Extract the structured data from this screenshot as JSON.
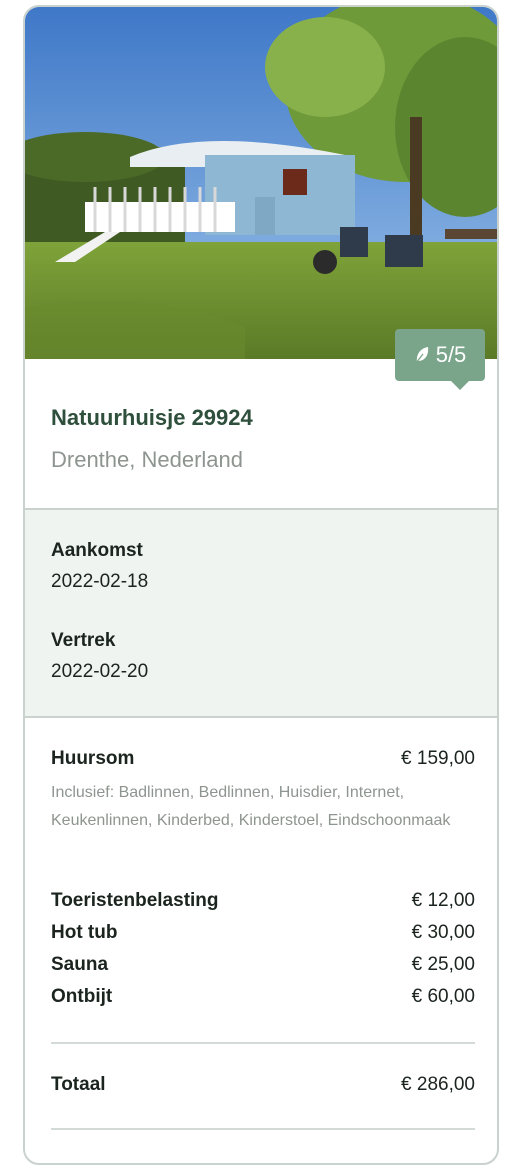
{
  "listing": {
    "name": "Natuurhuisje 29924",
    "location": "Drenthe, Nederland",
    "eco_rating": "5/5",
    "eco_icon": "leaf-icon"
  },
  "stay": {
    "arrival_label": "Aankomst",
    "arrival_date": "2022-02-18",
    "departure_label": "Vertrek",
    "departure_date": "2022-02-20"
  },
  "costs": {
    "rent": {
      "label": "Huursom",
      "amount": "€ 159,00"
    },
    "includes": "Inclusief: Badlinnen, Bedlinnen, Huisdier, Internet, Keukenlinnen, Kinderbed, Kinderstoel, Eindschoonmaak",
    "extras": [
      {
        "label": "Toeristenbelasting",
        "amount": "€ 12,00"
      },
      {
        "label": "Hot tub",
        "amount": "€ 30,00"
      },
      {
        "label": "Sauna",
        "amount": "€ 25,00"
      },
      {
        "label": "Ontbijt",
        "amount": "€ 60,00"
      }
    ],
    "total": {
      "label": "Totaal",
      "amount": "€ 286,00"
    }
  },
  "colors": {
    "title": "#2e4f3b",
    "badge": "#7aa58a",
    "dates_bg": "#eff4f0"
  }
}
